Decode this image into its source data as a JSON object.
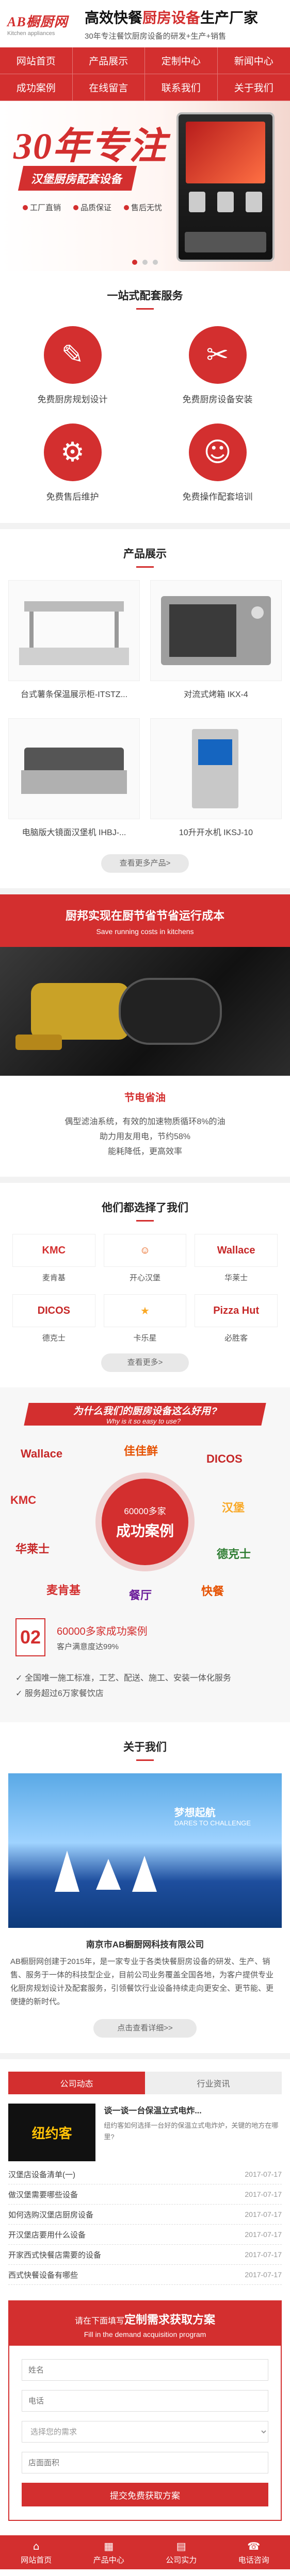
{
  "header": {
    "logo": "AB橱厨网",
    "logo_sub": "Kitchen appliances",
    "title_black_1": "高效快餐",
    "title_red": "厨房设备",
    "title_black_2": "生产厂家",
    "subtitle": "30年专注餐饮厨房设备的研发+生产+销售"
  },
  "nav": [
    {
      "label": "网站首页"
    },
    {
      "label": "产品展示"
    },
    {
      "label": "定制中心"
    },
    {
      "label": "新闻中心"
    },
    {
      "label": "成功案例"
    },
    {
      "label": "在线留言"
    },
    {
      "label": "联系我们"
    },
    {
      "label": "关于我们"
    }
  ],
  "banner": {
    "big": "30年专注",
    "strip": "汉堡厨房配套设备",
    "features": [
      "工厂直销",
      "品质保证",
      "售后无忧"
    ]
  },
  "services": {
    "title": "一站式配套服务",
    "items": [
      {
        "label": "免费厨房规划设计",
        "icon": "pencil-icon",
        "glyph": "✎"
      },
      {
        "label": "免费厨房设备安装",
        "icon": "wrench-icon",
        "glyph": "✂"
      },
      {
        "label": "免费售后维护",
        "icon": "gear-icon",
        "glyph": "⚙"
      },
      {
        "label": "免费操作配套培训",
        "icon": "person-icon",
        "glyph": "☺"
      }
    ]
  },
  "products": {
    "title": "产品展示",
    "items": [
      {
        "name": "台式薯条保温展示柜-ITSTZ..."
      },
      {
        "name": "对流式烤箱 IKX-4"
      },
      {
        "name": "电脑版大镜面汉堡机 IHBJ-..."
      },
      {
        "name": "10升开水机 IKSJ-10"
      }
    ],
    "more": "查看更多产品>"
  },
  "energy": {
    "title_prefix": "厨邦实现",
    "title_main": "在厨节省节省运行成本",
    "title_en": "Save running costs in kitchens",
    "sub": "节电省油",
    "desc": [
      "偶型滤油系统，有效的加速物质循环8%的油",
      "助力用友用电，节约58%",
      "能耗降低，更高效率"
    ]
  },
  "partners": {
    "title": "他们都选择了我们",
    "items": [
      {
        "name": "麦肯基",
        "logo": "KMC",
        "color": "#d32f2f"
      },
      {
        "name": "开心汉堡",
        "logo": "☺",
        "color": "#e65100"
      },
      {
        "name": "华莱士",
        "logo": "Wallace",
        "color": "#c62828"
      },
      {
        "name": "德克士",
        "logo": "DICOS",
        "color": "#c62828"
      },
      {
        "name": "卡乐星",
        "logo": "★",
        "color": "#f9a825"
      },
      {
        "name": "必胜客",
        "logo": "Pizza Hut",
        "color": "#c62828"
      }
    ],
    "more": "查看更多>"
  },
  "why": {
    "title": "为什么我们的厨房设备这么好用?",
    "title_en": "Why is it so easy to use?",
    "cloud": [
      "Wallace",
      "佳佳鲜",
      "DICOS",
      "KMC",
      "汉堡",
      "华莱士",
      "德克士",
      "麦肯基",
      "餐厅",
      "快餐"
    ],
    "circle_top": "60000多家",
    "circle_main": "成功案例",
    "point_num": "02",
    "point_title": "60000多家成功案例",
    "point_sub": "客户满意度达99%",
    "list": [
      "全国唯一施工标准，工艺、配送、施工、安装一体化服务",
      "服务超过6万家餐饮店"
    ]
  },
  "about": {
    "title": "关于我们",
    "tagline": "梦想起航",
    "tagline_en": "DARES TO CHALLENGE",
    "company": "南京市AB橱厨网科技有限公司",
    "text": "AB橱厨网创建于2015年，是一家专业于各类快餐厨房设备的研发、生产、销售、服务于一体的科技型企业，目前公司业务覆盖全国各地，为客户提供专业化厨房规划设计及配套服务，引领餐饮行业设备持续走向更安全、更节能、更便捷的新时代。",
    "more": "点击查看详细>>"
  },
  "news": {
    "tabs": [
      "公司动态",
      "行业资讯"
    ],
    "top": {
      "thumb": "纽约客",
      "title": "谈一谈一台保温立式电炸...",
      "desc": "纽约客如何选择一台好的保温立式电炸炉，关键的地方在哪里?"
    },
    "rows": [
      {
        "title": "汉堡店设备清单(一)",
        "date": "2017-07-17"
      },
      {
        "title": "做汉堡需要哪些设备",
        "date": "2017-07-17"
      },
      {
        "title": "如何选购汉堡店厨房设备",
        "date": "2017-07-17"
      },
      {
        "title": "开汉堡店要用什么设备",
        "date": "2017-07-17"
      },
      {
        "title": "开家西式快餐店需要的设备",
        "date": "2017-07-17"
      },
      {
        "title": "西式快餐设备有哪些",
        "date": "2017-07-17"
      }
    ]
  },
  "form": {
    "title_pre": "请在下面填写",
    "title_main": "定制需求获取方案",
    "subtitle": "Fill in the demand acquisition program",
    "name_ph": "姓名",
    "phone_ph": "电话",
    "select_ph": "选择您的需求",
    "area_ph": "店面面积",
    "submit": "提交免费获取方案"
  },
  "footer": [
    {
      "label": "网站首页",
      "icon": "home-icon",
      "glyph": "⌂"
    },
    {
      "label": "产品中心",
      "icon": "grid-icon",
      "glyph": "▦"
    },
    {
      "label": "公司实力",
      "icon": "building-icon",
      "glyph": "▤"
    },
    {
      "label": "电话咨询",
      "icon": "phone-icon",
      "glyph": "☎"
    }
  ]
}
